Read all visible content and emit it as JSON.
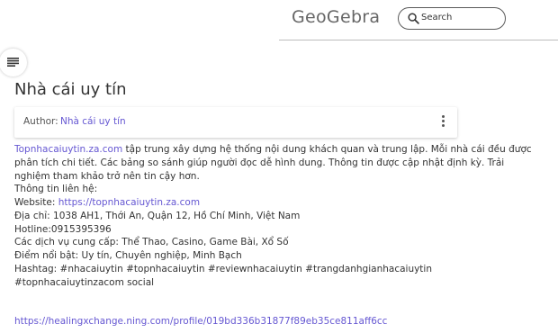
{
  "header": {
    "logo": "GeoGebra",
    "search_placeholder": "Search"
  },
  "page": {
    "title": "Nhà cái uy tín",
    "author_label": "Author:",
    "author_name": "Nhà cái uy tín"
  },
  "content": {
    "intro_link": "Topnhacaiuytin.za.com",
    "intro_text": " tập trung xây dựng hệ thống nội dung khách quan và trung lập. Mỗi nhà cái đều được phân tích chi tiết. Các bảng so sánh giúp người đọc dễ hình dung. Thông tin được cập nhật định kỳ. Trải nghiệm tham khảo trở nên tin cậy hơn.",
    "contact_heading": "Thông tin liên hệ:",
    "website_label": "Website: ",
    "website_link": "https://topnhacaiuytin.za.com",
    "address": "Địa chỉ: 1038 AH1, Thới An, Quận 12, Hồ Chí Minh, Việt Nam",
    "hotline": "Hotline:0915395396",
    "services": "Các dịch vụ cung cấp: Thể Thao, Casino, Game Bài, Xổ Số",
    "highlights": "Điểm nổi bật: Uy tín, Chuyên nghiệp, Minh Bạch",
    "hashtags": "Hashtag: #nhacaiuytin #topnhacaiuytin #reviewnhacaiuytin #trangdanhgianhacaiuytin #topnhacaiuytinzacom social",
    "profile_link": "https://healingxchange.ning.com/profile/019bd336b31877f89eb35ce811aff6cc"
  }
}
